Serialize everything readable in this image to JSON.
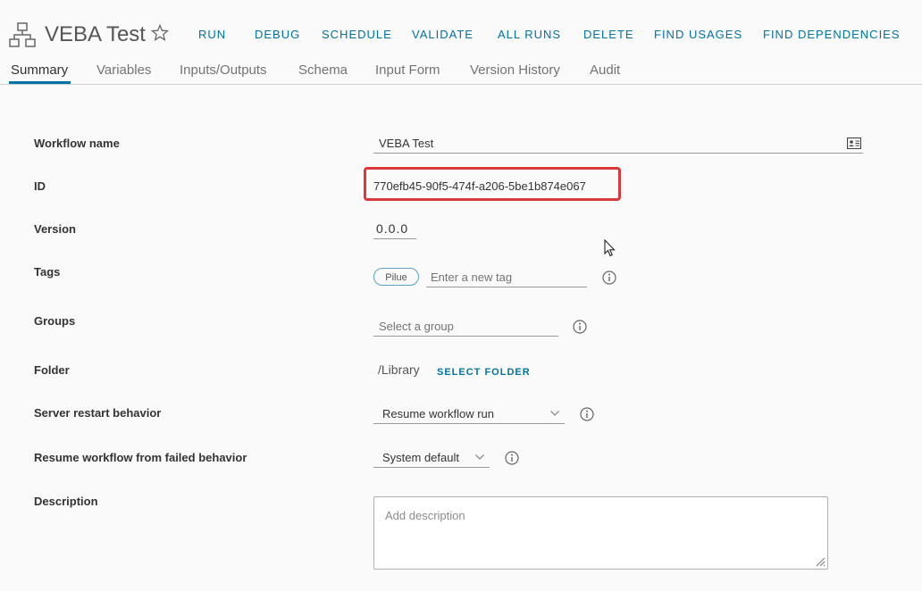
{
  "header": {
    "title": "VEBA Test",
    "actions": [
      "RUN",
      "DEBUG",
      "SCHEDULE",
      "VALIDATE",
      "ALL RUNS",
      "DELETE",
      "FIND USAGES",
      "FIND DEPENDENCIES"
    ]
  },
  "tabs": [
    "Summary",
    "Variables",
    "Inputs/Outputs",
    "Schema",
    "Input Form",
    "Version History",
    "Audit"
  ],
  "form": {
    "workflow_name_label": "Workflow name",
    "workflow_name_value": "VEBA Test",
    "id_label": "ID",
    "id_value": "770efb45-90f5-474f-a206-5be1b874e067",
    "version_label": "Version",
    "version_value": "0.0.0",
    "tags_label": "Tags",
    "tag_pill": "Pilue",
    "tag_placeholder": "Enter a new tag",
    "groups_label": "Groups",
    "groups_placeholder": "Select a group",
    "folder_label": "Folder",
    "folder_value": "/Library",
    "select_folder": "SELECT FOLDER",
    "server_restart_label": "Server restart behavior",
    "server_restart_value": "Resume workflow run",
    "resume_failed_label": "Resume workflow from failed behavior",
    "resume_failed_value": "System default",
    "description_label": "Description",
    "description_placeholder": "Add description"
  },
  "colors": {
    "accent": "#0072a3",
    "highlight_border": "#d9393d"
  }
}
